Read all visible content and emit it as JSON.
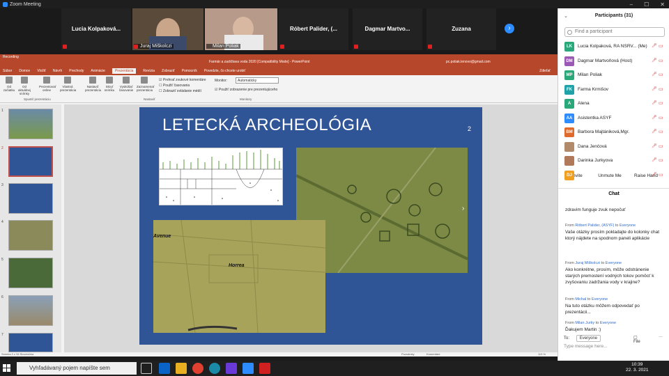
{
  "window": {
    "title": "Zoom Meeting"
  },
  "video_strip": {
    "tiles": [
      {
        "name": "Lucia  Kolpaková...",
        "type": "name"
      },
      {
        "name": "Juraj Miškolczi",
        "type": "video"
      },
      {
        "name": "Milan Poliak",
        "type": "video"
      },
      {
        "name": "Róbert  Palider,  (...",
        "type": "name"
      },
      {
        "name": "Dagmar  Martvo...",
        "type": "name"
      },
      {
        "name": "Zuzana",
        "type": "name"
      }
    ]
  },
  "powerpoint": {
    "title": "Farmár a zadržiava voda 2020 [Compatibility Mode] - PowerPoint",
    "user": "pc.poliak.lenovo@gmail.com",
    "share": "Zdieľať",
    "recording": "Recording",
    "tabs": [
      "Súbor",
      "Domov",
      "Vložiť",
      "Návrh",
      "Prechody",
      "Animácie",
      "Prezentácia",
      "Revízia",
      "Zobraziť",
      "Pomocník"
    ],
    "tell_me": "Povedzte, čo chcete urobiť",
    "ribbon": {
      "btn1": "Od začiatku",
      "btn2": "Od aktuálnej snímky",
      "btn3": "Prezentovať online",
      "btn4": "Vlastná prezentácia",
      "group1": "Spustiť prezentáciu",
      "btn5": "Nastaviť prezentáciu",
      "btn6": "Skryť snímku",
      "btn7": "Vyskúšať časovanie",
      "btn8": "Zaznamenať prezentáciu",
      "chk1": "Prehrať zvukové komentáre",
      "chk2": "Použiť časovania",
      "chk3": "Zobraziť ovládanie médií",
      "group2": "Nastaviť",
      "monitor_label": "Monitor:",
      "monitor_value": "Automaticky",
      "chk4": "Použiť zobrazenie pre prezentujúceho",
      "group3": "Monitory"
    },
    "slide": {
      "title": "LETECKÁ ARCHEOLÓGIA",
      "number": "2",
      "label_avenue": "Avenue",
      "label_horrea": "Horrea"
    },
    "thumb_numbers": [
      "1",
      "2",
      "3",
      "4",
      "5",
      "6",
      "7"
    ],
    "status": {
      "left": "Snímka 2 z 34   Slovenčina",
      "notes": "Poznámky",
      "comments": "Komentáre",
      "zoom": "113 %"
    }
  },
  "participants": {
    "header": "Participants (31)",
    "search_placeholder": "Find a participant",
    "list": [
      {
        "initials": "LK",
        "name": "Lucia Kolpaková, RA NSRV... (Me)",
        "color": "#2aa87a"
      },
      {
        "initials": "DM",
        "name": "Dagmar Martvoňová (Host)",
        "color": "#9b59b6"
      },
      {
        "initials": "MP",
        "name": "Milan Poliak",
        "color": "#2aa87a"
      },
      {
        "initials": "FK",
        "name": "Farma Krmišov",
        "color": "#1fa3a8"
      },
      {
        "initials": "A",
        "name": "Alena",
        "color": "#2aa87a"
      },
      {
        "initials": "AA",
        "name": "Asistentka ASYF",
        "color": "#2d8cff"
      },
      {
        "initials": "BM",
        "name": "Barbora Majtániková,Mgr.",
        "color": "#e06a2b"
      },
      {
        "initials": "",
        "name": "Dana Jenčová",
        "color": "#b08a6a"
      },
      {
        "initials": "",
        "name": "Darinka Jurkyova",
        "color": "#b07a5a"
      },
      {
        "initials": "DJ",
        "name": "",
        "color": "#f0a020"
      }
    ],
    "buttons": {
      "invite": "Invite",
      "unmute": "Unmute Me",
      "raise": "Raise Hand"
    }
  },
  "chat": {
    "header": "Chat",
    "messages": [
      {
        "from": "",
        "to": "",
        "text": "zdravim funguje zvuk nepočuť"
      },
      {
        "from": "Róbert Palider, (ASYF)",
        "to": "Everyone",
        "text": "Vaše otázky prosím pokladajte do kolonky chat ktorý nájdete na spodnom paneli aplikácie"
      },
      {
        "from": "Juraj Miškolczi",
        "to": "Everyone",
        "text": "Ako konkrétne, prosím, môže odstránenie starých premostení vodných tokov pomôcť k zvyšovaniu zadržania vody v krajine?"
      },
      {
        "from": "Michal",
        "to": "Everyone",
        "text": "Na tuto otázku môžem odpovedať po prezentácii..."
      },
      {
        "from": "Milan Jurky",
        "to": "Everyone",
        "text": "Ďakujem Martin :)"
      }
    ],
    "from_word": "From",
    "to_word": "to",
    "to_label": "To:",
    "to_value": "Everyone",
    "file_label": "File",
    "input_placeholder": "Type message here..."
  },
  "taskbar": {
    "search_placeholder": "Vyhľadávaný pojem napíšte sem",
    "time": "10:39",
    "date": "22. 3. 2021"
  }
}
